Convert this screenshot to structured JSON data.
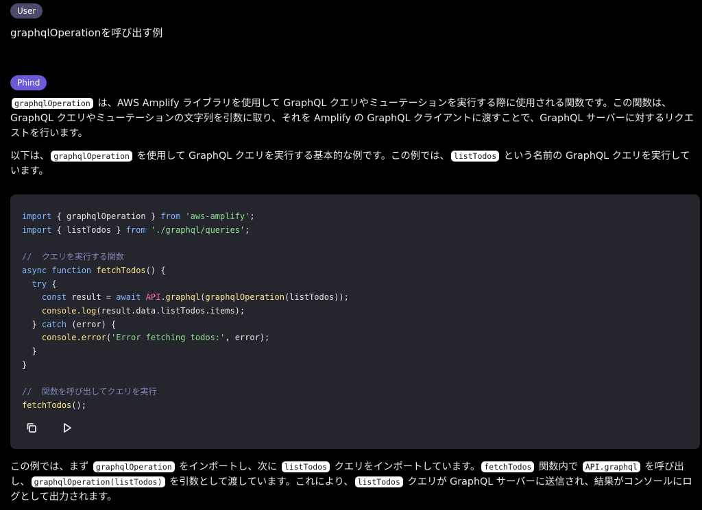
{
  "user": {
    "badge": "User",
    "message": "graphqlOperationを呼び出す例"
  },
  "assistant": {
    "badge": "Phind",
    "p1": {
      "code1": "graphqlOperation",
      "text1": " は、AWS Amplify ライブラリを使用して GraphQL クエリやミューテーションを実行する際に使用される関数です。この関数は、GraphQL クエリやミューテーションの文字列を引数に取り、それを Amplify の GraphQL クライアントに渡すことで、GraphQL サーバーに対するリクエストを行います。"
    },
    "p2": {
      "text0": "以下は、",
      "code1": "graphqlOperation",
      "text1": " を使用して GraphQL クエリを実行する基本的な例です。この例では、",
      "code2": "listTodos",
      "text2": " という名前の GraphQL クエリを実行しています。"
    },
    "p3": {
      "text0": "この例では、まず ",
      "code1": "graphqlOperation",
      "text1": " をインポートし、次に ",
      "code2": "listTodos",
      "text2": " クエリをインポートしています。",
      "code3": "fetchTodos",
      "text3": " 関数内で ",
      "code4": "API.graphql",
      "text4": " を呼び出し、",
      "code5": "graphqlOperation(listTodos)",
      "text5": " を引数として渡しています。これにより、",
      "code6": "listTodos",
      "text6": " クエリが GraphQL サーバーに送信され、結果がコンソールにログとして出力されます。"
    }
  },
  "code": {
    "l1_kw": "import",
    "l1_a": " { graphqlOperation } ",
    "l1_from": "from",
    "l1_str": "'aws-amplify'",
    "l1_end": ";",
    "l2_kw": "import",
    "l2_a": " { listTodos } ",
    "l2_from": "from",
    "l2_str": "'./graphql/queries'",
    "l2_end": ";",
    "l4_cm": "//  クエリを実行する関数",
    "l5_kw": "async function",
    "l5_fn": "fetchTodos",
    "l5_rest": "() {",
    "l6_kw": "try",
    "l6_rest": " {",
    "l7_kw": "const",
    "l7_a": " result = ",
    "l7_kw2": "await",
    "l7_api": "API",
    "l7_fn": ".graphql",
    "l7_p": "(",
    "l7_fn2": "graphqlOperation",
    "l7_rest": "(listTodos));",
    "l8_fn": "console",
    "l8_fn2": ".log",
    "l8_rest": "(result.data.listTodos.items);",
    "l9_a": "} ",
    "l9_kw": "catch",
    "l9_rest": " (error) {",
    "l10_fn": "console",
    "l10_fn2": ".error",
    "l10_p": "(",
    "l10_str": "'Error fetching todos:'",
    "l10_rest": ", error);",
    "l11": "}",
    "l12": "}",
    "l14_cm": "//  関数を呼び出してクエリを実行",
    "l15_fn": "fetchTodos",
    "l15_rest": "();",
    "actions": {
      "copy_icon": "copy-icon",
      "run_icon": "play-icon"
    }
  },
  "colors": {
    "background": "#000000",
    "code_bg": "#24252d",
    "user_badge": "#4b4b6e",
    "phind_badge": "#6a5ad8"
  }
}
